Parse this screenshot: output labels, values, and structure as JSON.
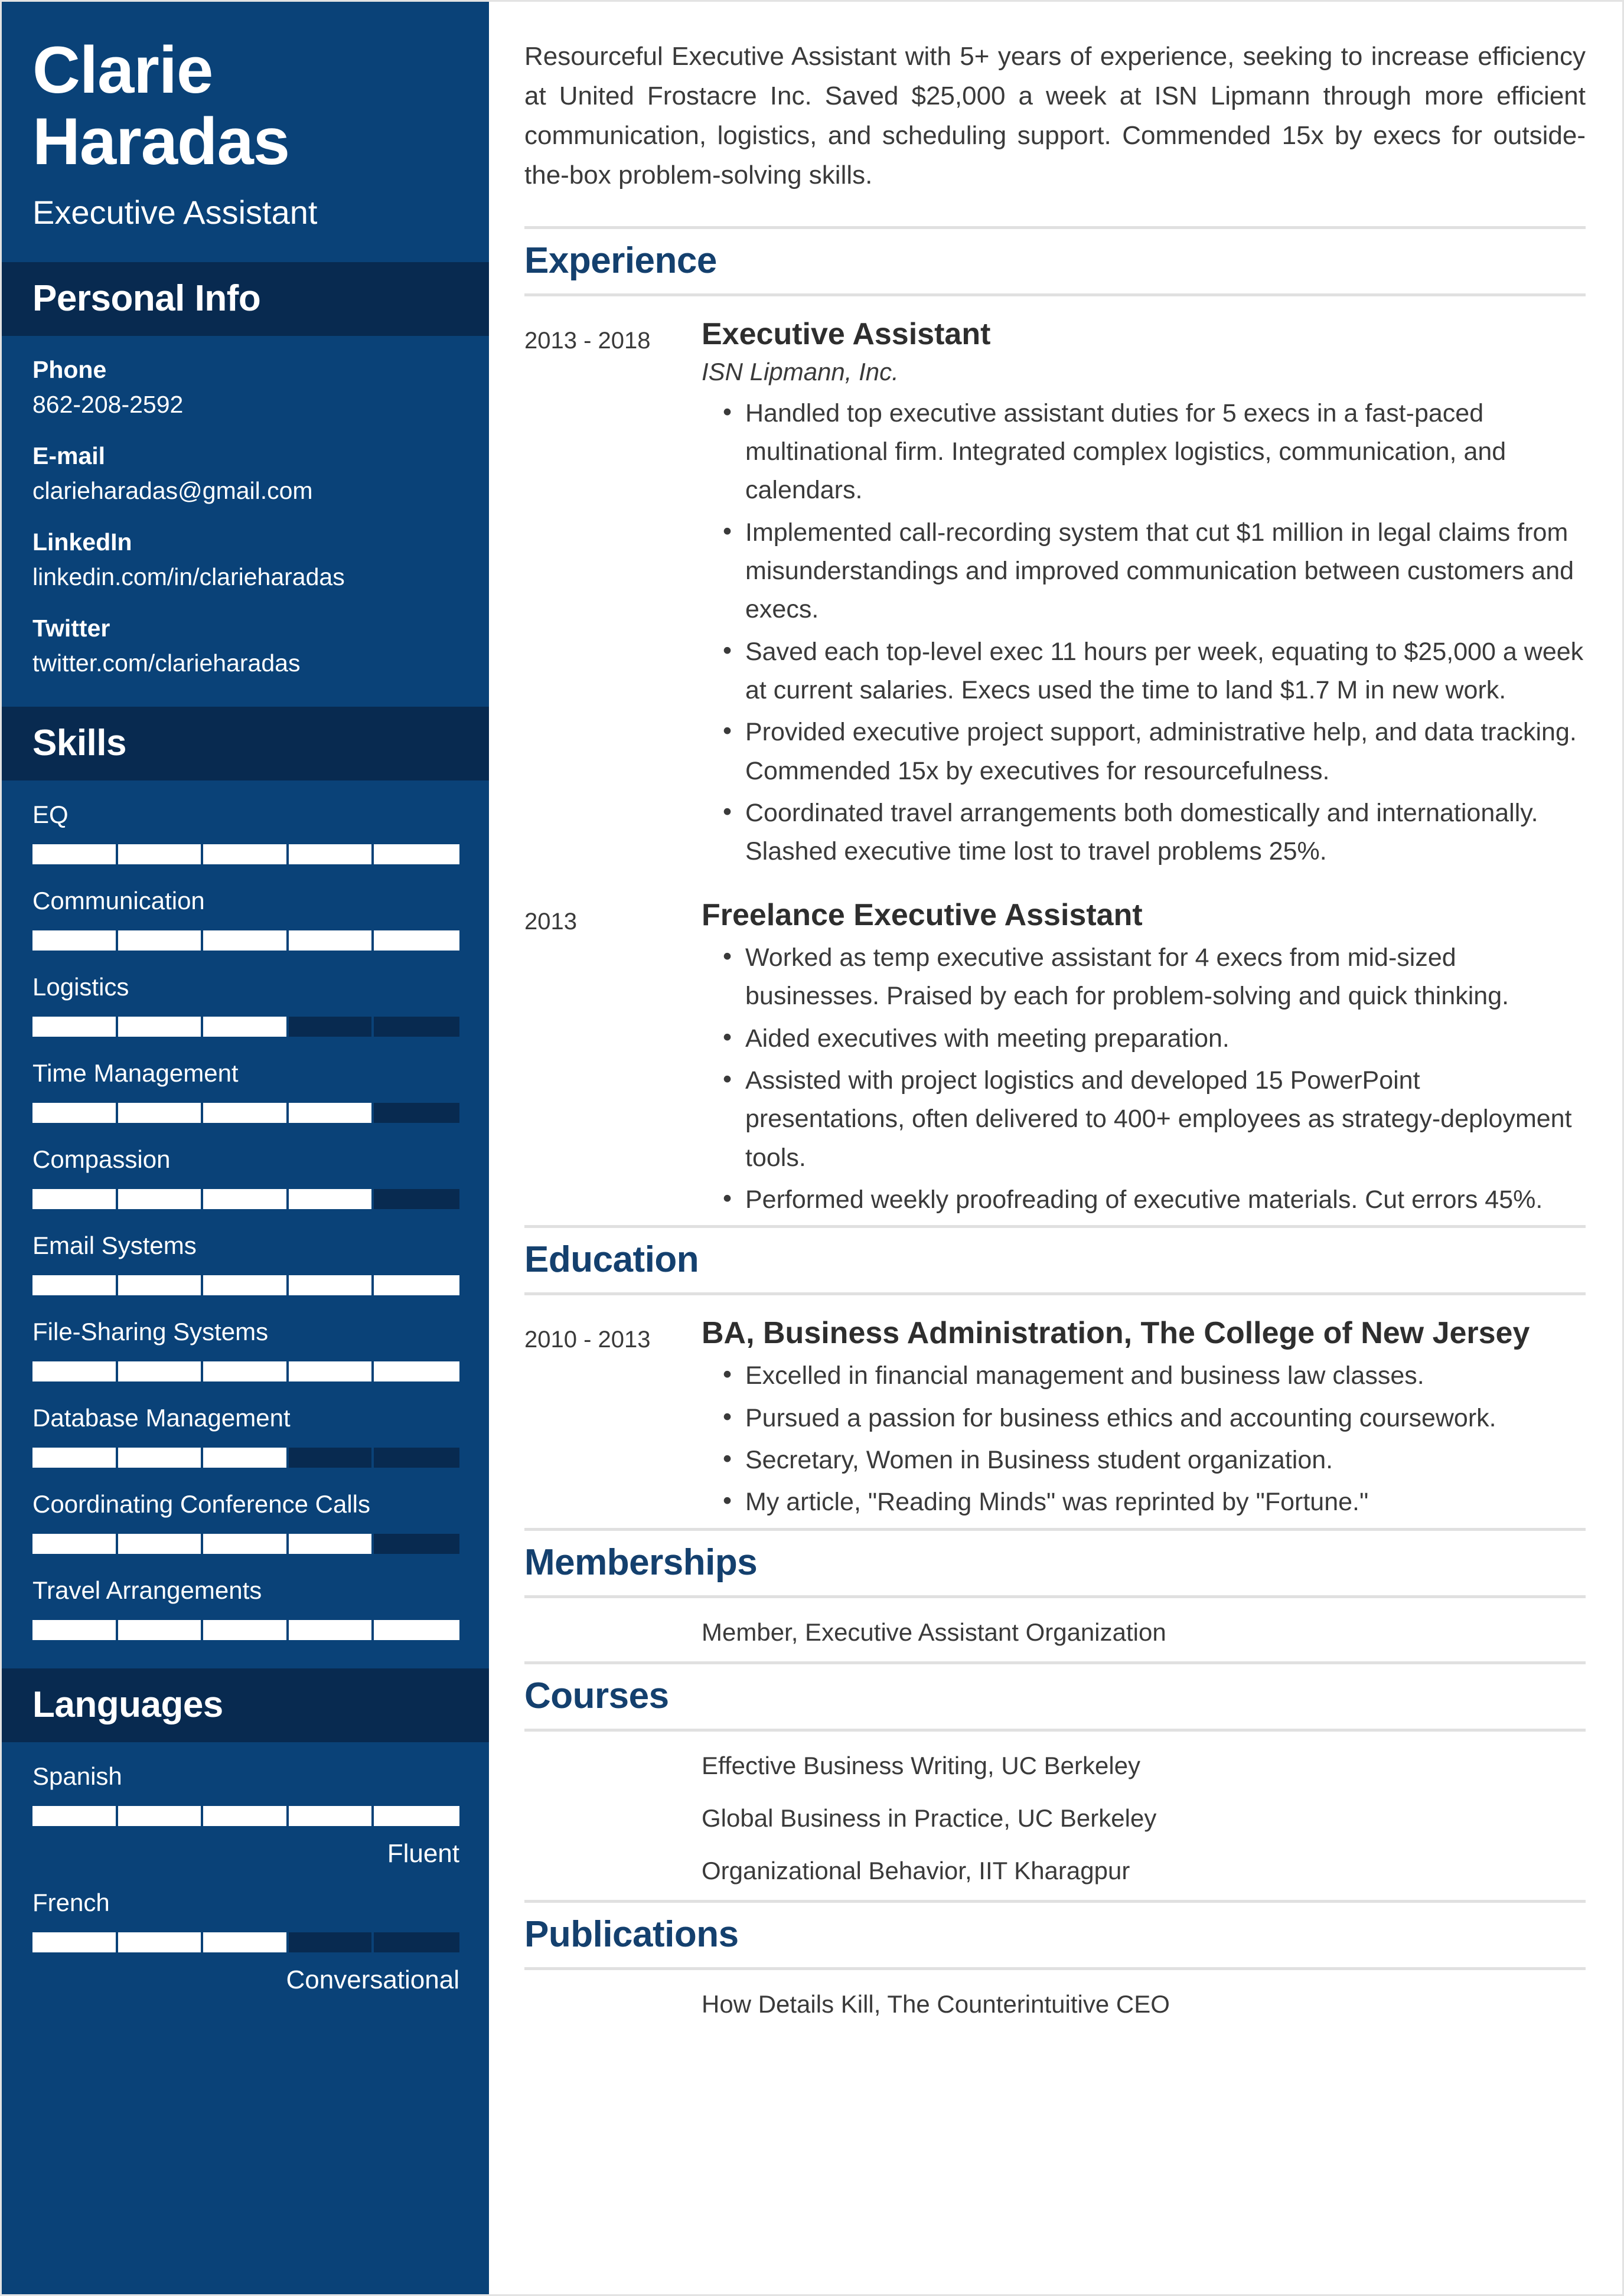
{
  "colors": {
    "sidebar_bg": "#0a4278",
    "sidebar_band": "#082a50",
    "heading_blue": "#14406e",
    "bar_fill": "#ffffff",
    "rule": "#e0e0e0"
  },
  "sidebar": {
    "first_name": "Clarie",
    "last_name": "Haradas",
    "job_title": "Executive Assistant",
    "personal_info": {
      "heading": "Personal Info",
      "items": [
        {
          "label": "Phone",
          "value": "862-208-2592"
        },
        {
          "label": "E-mail",
          "value": "clarieharadas@gmail.com"
        },
        {
          "label": "LinkedIn",
          "value": "linkedin.com/in/clarieharadas"
        },
        {
          "label": "Twitter",
          "value": "twitter.com/clarieharadas"
        }
      ]
    },
    "skills": {
      "heading": "Skills",
      "items": [
        {
          "name": "EQ",
          "level": 100
        },
        {
          "name": "Communication",
          "level": 100
        },
        {
          "name": "Logistics",
          "level": 60
        },
        {
          "name": "Time Management",
          "level": 80
        },
        {
          "name": "Compassion",
          "level": 80
        },
        {
          "name": "Email Systems",
          "level": 100
        },
        {
          "name": "File-Sharing Systems",
          "level": 100
        },
        {
          "name": "Database Management",
          "level": 60
        },
        {
          "name": "Coordinating Conference Calls",
          "level": 80
        },
        {
          "name": "Travel Arrangements",
          "level": 100
        }
      ]
    },
    "languages": {
      "heading": "Languages",
      "items": [
        {
          "name": "Spanish",
          "level": 100,
          "proficiency": "Fluent"
        },
        {
          "name": "French",
          "level": 60,
          "proficiency": "Conversational"
        }
      ]
    }
  },
  "main": {
    "summary": "Resourceful Executive Assistant with 5+ years of experience, seeking to increase efficiency at United Frostacre Inc. Saved $25,000 a week at ISN Lipmann through more efficient communication, logistics, and scheduling support. Commended 15x by execs for outside-the-box problem-solving skills.",
    "experience": {
      "heading": "Experience",
      "entries": [
        {
          "dates": "2013 - 2018",
          "title": "Executive Assistant",
          "company": "ISN Lipmann, Inc.",
          "bullets": [
            "Handled top executive assistant duties for 5 execs in a fast-paced multinational firm. Integrated complex logistics, communication, and calendars.",
            "Implemented call-recording system that cut $1 million in legal claims from misunderstandings and improved communication between customers and execs.",
            "Saved each top-level exec 11 hours per week, equating to $25,000 a week at current salaries. Execs used the time to land $1.7 M in new work.",
            "Provided executive project support, administrative help, and data tracking. Commended 15x by executives for resourcefulness.",
            "Coordinated travel arrangements both domestically and internationally. Slashed executive time lost to travel problems 25%."
          ]
        },
        {
          "dates": "2013",
          "title": "Freelance Executive Assistant",
          "company": "",
          "bullets": [
            "Worked as temp executive assistant for 4 execs from mid-sized businesses. Praised by each for problem-solving and quick thinking.",
            "Aided executives with meeting preparation.",
            "Assisted with project logistics and developed 15 PowerPoint presentations, often delivered to 400+ employees as strategy-deployment tools.",
            "Performed weekly proofreading of executive materials. Cut errors 45%."
          ]
        }
      ]
    },
    "education": {
      "heading": "Education",
      "entries": [
        {
          "dates": "2010 - 2013",
          "title": "BA, Business Administration, The College of New Jersey",
          "bullets": [
            "Excelled in financial management and business law classes.",
            "Pursued a passion for business ethics and accounting coursework.",
            "Secretary, Women in Business student organization.",
            "My article, \"Reading Minds\" was reprinted by \"Fortune.\""
          ]
        }
      ]
    },
    "memberships": {
      "heading": "Memberships",
      "items": [
        "Member, Executive Assistant Organization"
      ]
    },
    "courses": {
      "heading": "Courses",
      "items": [
        "Effective Business Writing, UC Berkeley",
        "Global Business in Practice, UC Berkeley",
        "Organizational Behavior, IIT Kharagpur"
      ]
    },
    "publications": {
      "heading": "Publications",
      "items": [
        "How Details Kill, The Counterintuitive CEO"
      ]
    }
  }
}
